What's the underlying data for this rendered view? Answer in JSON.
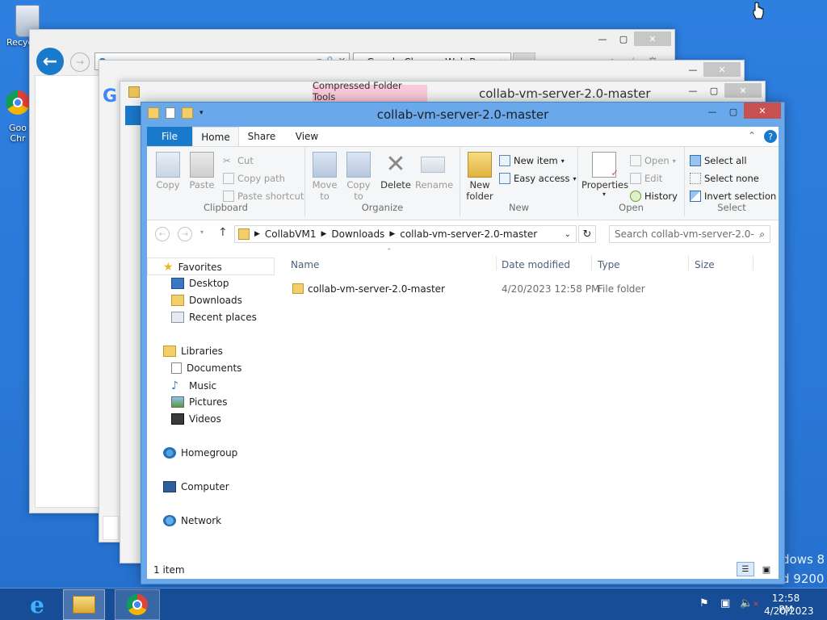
{
  "desktop": {
    "recycle_label": "Recyc",
    "chrome_label_1": "Goo",
    "chrome_label_2": "Chr",
    "watermark_1": "dows 8",
    "watermark_2": "d 9200"
  },
  "ie": {
    "tab_title": "Google Chrome Web Brows...",
    "close_tab": "×"
  },
  "explorer_back": {
    "ribbon_tab": "Compressed Folder Tools",
    "title": "collab-vm-server-2.0-master"
  },
  "explorer": {
    "title": "collab-vm-server-2.0-master",
    "tabs": [
      "File",
      "Home",
      "Share",
      "View"
    ],
    "clipboard": {
      "copy": "Copy",
      "paste": "Paste",
      "cut": "Cut",
      "copy_path": "Copy path",
      "paste_shortcut": "Paste shortcut",
      "label": "Clipboard"
    },
    "organize": {
      "move_to_1": "Move",
      "move_to_2": "to",
      "copy_to_1": "Copy",
      "copy_to_2": "to",
      "delete": "Delete",
      "rename": "Rename",
      "label": "Organize"
    },
    "new": {
      "new_folder_1": "New",
      "new_folder_2": "folder",
      "new_item": "New item",
      "easy_access": "Easy access",
      "label": "New"
    },
    "open": {
      "properties": "Properties",
      "open": "Open",
      "edit": "Edit",
      "history": "History",
      "label": "Open"
    },
    "select": {
      "select_all": "Select all",
      "select_none": "Select none",
      "invert": "Invert selection",
      "label": "Select"
    },
    "address": {
      "crumbs": [
        "CollabVM1",
        "Downloads",
        "collab-vm-server-2.0-master"
      ],
      "search_placeholder": "Search collab-vm-server-2.0-..."
    },
    "nav": {
      "favorites": "Favorites",
      "desktop": "Desktop",
      "downloads": "Downloads",
      "recent": "Recent places",
      "libraries": "Libraries",
      "documents": "Documents",
      "music": "Music",
      "pictures": "Pictures",
      "videos": "Videos",
      "homegroup": "Homegroup",
      "computer": "Computer",
      "network": "Network"
    },
    "columns": {
      "name": "Name",
      "date": "Date modified",
      "type": "Type",
      "size": "Size"
    },
    "files": [
      {
        "name": "collab-vm-server-2.0-master",
        "date": "4/20/2023 12:58 PM",
        "type": "File folder",
        "size": ""
      }
    ],
    "status": "1 item"
  },
  "taskbar": {
    "time": "12:58 PM",
    "date": "4/20/2023"
  },
  "colors": {
    "accent": "#1979ca",
    "desktop": "#2a78d8",
    "titlebar": "#6aa8ec",
    "close": "#c75050",
    "ribbon_tab": "#f9c9d9"
  }
}
